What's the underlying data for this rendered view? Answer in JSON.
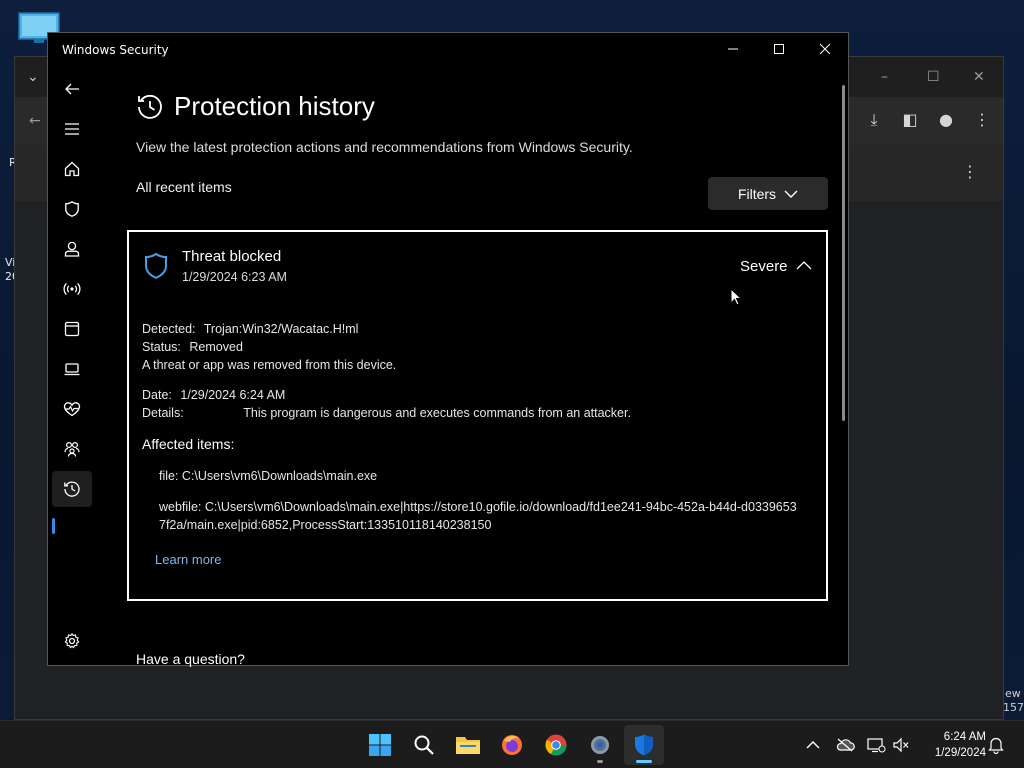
{
  "window": {
    "title": "Windows Security",
    "minimize": "–",
    "maximize": "☐",
    "close": "✕"
  },
  "page": {
    "title": "Protection history",
    "subtitle": "View the latest protection actions and recommendations from Windows Security.",
    "section_label": "All recent items",
    "filters_label": "Filters",
    "question": "Have a question?"
  },
  "sidebar": {
    "items": [
      {
        "name": "back",
        "icon": "arrow-left-icon"
      },
      {
        "name": "menu",
        "icon": "hamburger-icon"
      },
      {
        "name": "home",
        "icon": "home-icon"
      },
      {
        "name": "virus-protection",
        "icon": "shield-icon"
      },
      {
        "name": "account-protection",
        "icon": "person-icon"
      },
      {
        "name": "firewall",
        "icon": "antenna-icon"
      },
      {
        "name": "app-browser-control",
        "icon": "browser-icon"
      },
      {
        "name": "device-security",
        "icon": "laptop-icon"
      },
      {
        "name": "device-performance",
        "icon": "heart-pulse-icon"
      },
      {
        "name": "family-options",
        "icon": "family-icon"
      },
      {
        "name": "protection-history",
        "icon": "history-icon"
      },
      {
        "name": "settings",
        "icon": "gear-icon"
      }
    ]
  },
  "threat": {
    "title": "Threat blocked",
    "date": "1/29/2024 6:23 AM",
    "severity": "Severe",
    "detected_key": "Detected:",
    "detected_value": "Trojan:Win32/Wacatac.H!ml",
    "status_key": "Status:",
    "status_value": "Removed",
    "status_note": "A threat or app was removed from this device.",
    "date_key": "Date:",
    "date_value": "1/29/2024 6:24 AM",
    "details_key": "Details:",
    "details_value": "This program is dangerous and executes commands from an attacker.",
    "affected_label": "Affected items:",
    "affected_items": [
      "file: C:\\Users\\vm6\\Downloads\\main.exe",
      "webfile: C:\\Users\\vm6\\Downloads\\main.exe|https://store10.gofile.io/download/fd1ee241-94bc-452a-b44d-d03396537f2a/main.exe|pid:6852,ProcessStart:133510118140238150"
    ],
    "learn_more": "Learn more"
  },
  "desktop": {
    "text_left_1": "R",
    "text_left_2": "Vi",
    "text_left_3": "20",
    "text_right_1": "ew",
    "text_right_2": "157"
  },
  "taskbar": {
    "apps": [
      "start-icon",
      "search-icon",
      "file-explorer-icon",
      "firefox-icon",
      "chrome-icon",
      "settings-icon",
      "windows-security-icon"
    ],
    "time": "6:24 AM",
    "date": "1/29/2024"
  },
  "colors": {
    "accent": "#3a88e8",
    "link": "#76b9ed",
    "taskbar": "#1c1c1c"
  }
}
